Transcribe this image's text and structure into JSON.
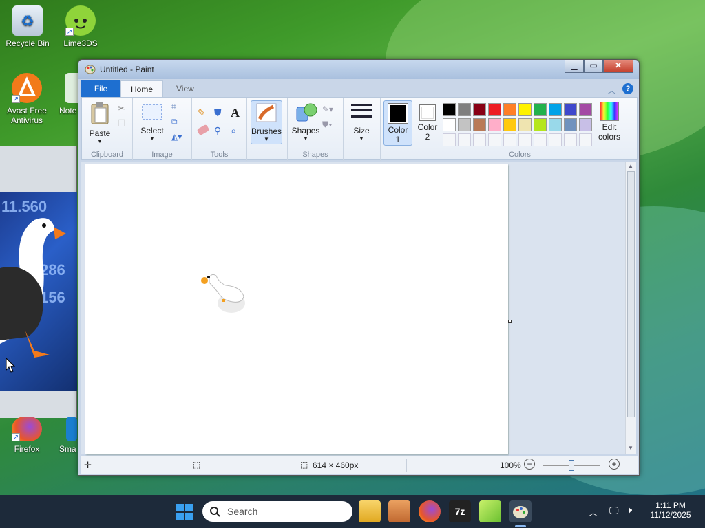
{
  "desktop": {
    "icons": [
      {
        "label": "Recycle Bin",
        "icon": "recycle-bin-icon"
      },
      {
        "label": "Lime3DS",
        "icon": "lime3ds-icon"
      },
      {
        "label": "Avast Free Antivirus",
        "icon": "avast-icon"
      },
      {
        "label": "Note",
        "icon": "notepad-icon"
      },
      {
        "label": "Firefox",
        "icon": "firefox-icon"
      },
      {
        "label": "Sma",
        "icon": "smart-icon"
      }
    ],
    "bg_numbers": [
      "11.560",
      "286",
      "156"
    ]
  },
  "paint": {
    "title": "Untitled - Paint",
    "window_buttons": {
      "minimize": "▁",
      "maximize": "▭",
      "close": "✕"
    },
    "tabs": [
      "File",
      "Home",
      "View"
    ],
    "ribbon": {
      "clipboard": {
        "paste": "Paste",
        "group": "Clipboard"
      },
      "image": {
        "select": "Select",
        "group": "Image"
      },
      "tools": {
        "group": "Tools",
        "text_glyph": "A"
      },
      "brushes": {
        "label": "Brushes"
      },
      "shapes": {
        "label": "Shapes",
        "group": "Shapes"
      },
      "size": {
        "label": "Size"
      },
      "color1": {
        "line1": "Color",
        "line2": "1",
        "value": "#000000"
      },
      "color2": {
        "line1": "Color",
        "line2": "2",
        "value": "#ffffff"
      },
      "colors_group": "Colors",
      "edit_colors": {
        "line1": "Edit",
        "line2": "colors"
      },
      "palette_row1": [
        "#000000",
        "#7f7f7f",
        "#880015",
        "#ed1c24",
        "#ff7f27",
        "#fff200",
        "#22b14c",
        "#00a2e8",
        "#3f48cc",
        "#a349a4"
      ],
      "palette_row2": [
        "#ffffff",
        "#c3c3c3",
        "#b97a57",
        "#ffaec9",
        "#ffc90e",
        "#efe4b0",
        "#b5e61d",
        "#99d9ea",
        "#7092be",
        "#c8bfe7"
      ]
    },
    "status": {
      "image_size": "614 × 460px",
      "zoom": "100%"
    }
  },
  "taskbar": {
    "search_placeholder": "Search",
    "time": "1:11 PM",
    "date": "11/12/2025",
    "pinned": [
      "file-explorer-icon",
      "media-player-icon",
      "firefox-icon",
      "7zip-icon",
      "notepad-icon",
      "paint-icon"
    ]
  }
}
